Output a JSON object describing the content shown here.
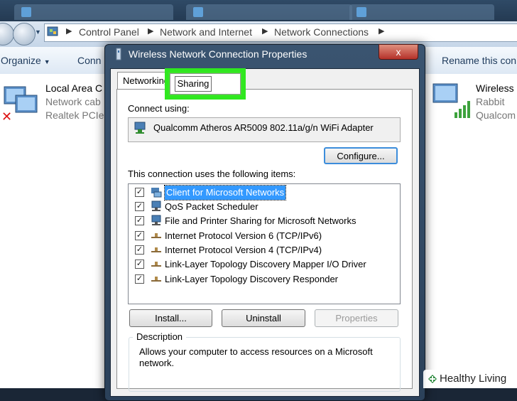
{
  "explorer": {
    "breadcrumbs": [
      "Control Panel",
      "Network and Internet",
      "Network Connections"
    ],
    "toolbar": {
      "organize": "Organize",
      "connect": "Conn",
      "rename": "Rename this con"
    },
    "connections": [
      {
        "name": "Local Area C",
        "status": "Network cab",
        "adapter": "Realtek PCIe"
      },
      {
        "name": "Wireless N",
        "status": "Rabbit",
        "adapter": "Qualcom"
      }
    ]
  },
  "dialog": {
    "title": "Wireless Network Connection Properties",
    "close": "x",
    "tabs": [
      "Networking",
      "Sharing"
    ],
    "connect_using_label": "Connect using:",
    "adapter": "Qualcomm Atheros AR5009 802.11a/g/n WiFi Adapter",
    "configure": "Configure...",
    "items_label": "This connection uses the following items:",
    "items": [
      {
        "label": "Client for Microsoft Networks",
        "checked": true,
        "selected": true
      },
      {
        "label": "QoS Packet Scheduler",
        "checked": true
      },
      {
        "label": "File and Printer Sharing for Microsoft Networks",
        "checked": true
      },
      {
        "label": "Internet Protocol Version 6 (TCP/IPv6)",
        "checked": true
      },
      {
        "label": "Internet Protocol Version 4 (TCP/IPv4)",
        "checked": true
      },
      {
        "label": "Link-Layer Topology Discovery Mapper I/O Driver",
        "checked": true
      },
      {
        "label": "Link-Layer Topology Discovery Responder",
        "checked": true
      }
    ],
    "buttons": {
      "install": "Install...",
      "uninstall": "Uninstall",
      "properties": "Properties"
    },
    "description_label": "Description",
    "description": "Allows your computer to access resources on a Microsoft network."
  },
  "highlight_color": "#2fe81f",
  "watermark": "Healthy Living"
}
